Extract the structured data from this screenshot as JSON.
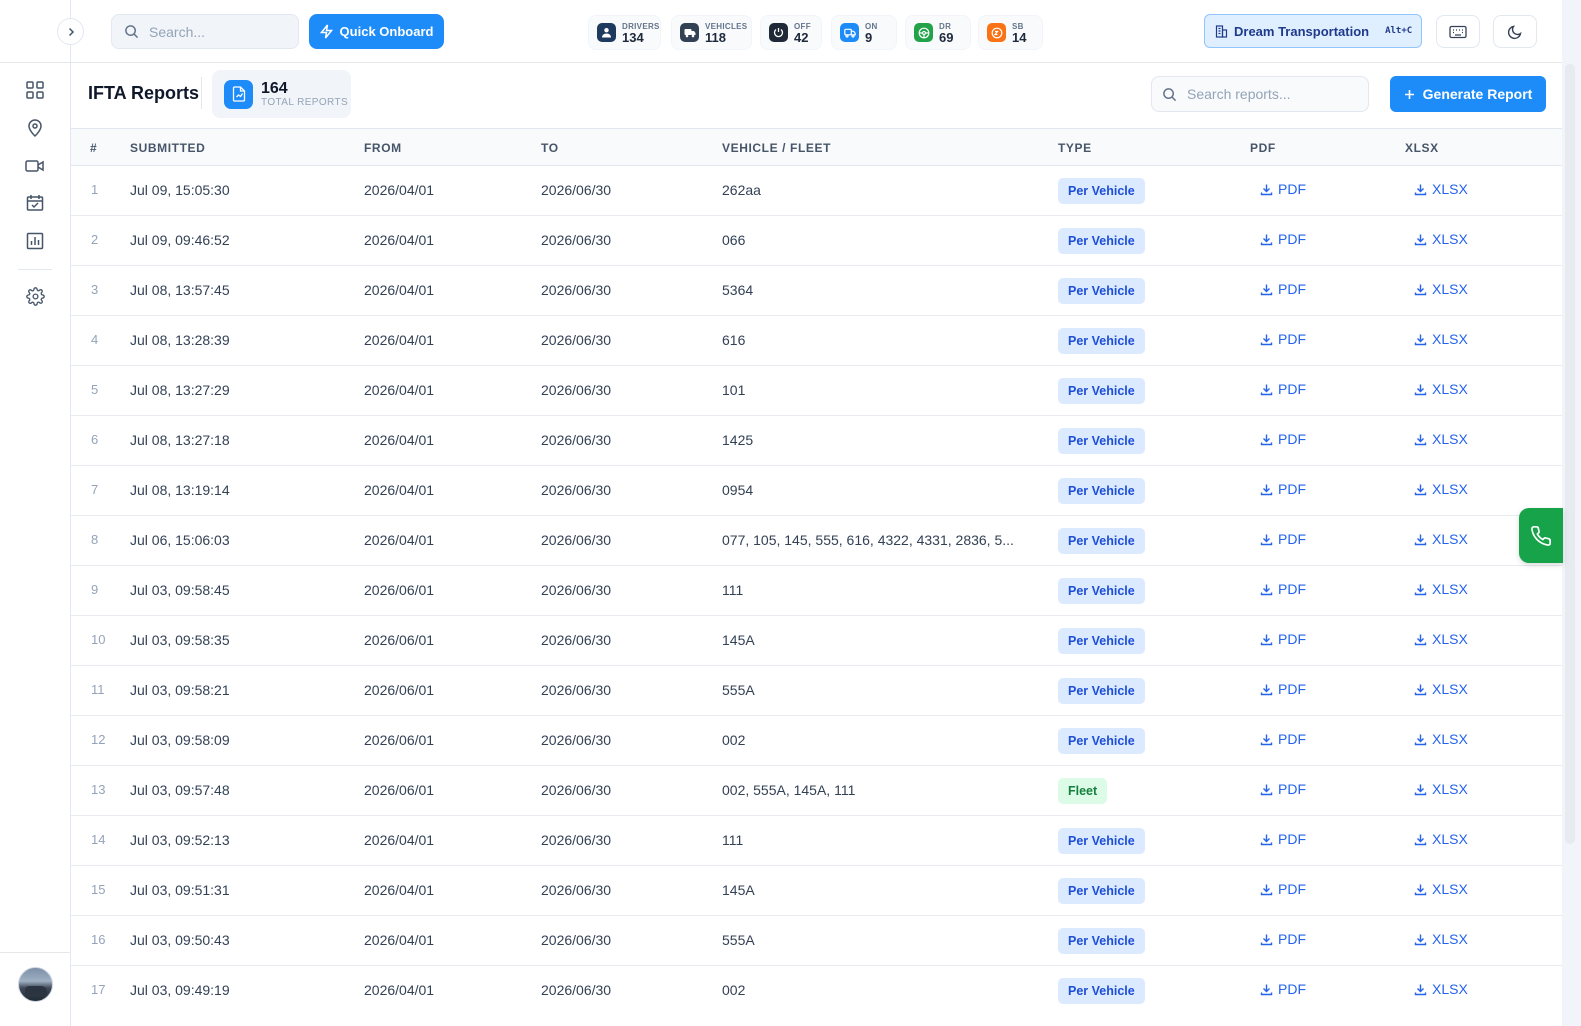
{
  "topbar": {
    "search_placeholder": "Search...",
    "quick_onboard_label": "Quick Onboard",
    "stats": [
      {
        "label": "DRIVERS",
        "value": "134",
        "icon": "driver-icon",
        "color": "#1e3a5f"
      },
      {
        "label": "VEHICLES",
        "value": "118",
        "icon": "truck-icon",
        "color": "#334155"
      },
      {
        "label": "OFF",
        "value": "42",
        "icon": "power-icon",
        "color": "#1f2937"
      },
      {
        "label": "ON",
        "value": "9",
        "icon": "truck-on-icon",
        "color": "#1d8cf8"
      },
      {
        "label": "DR",
        "value": "69",
        "icon": "steering-wheel-icon",
        "color": "#22a34a"
      },
      {
        "label": "SB",
        "value": "14",
        "icon": "sleep-icon",
        "color": "#f97316"
      }
    ],
    "org_name": "Dream Transportation",
    "org_shortcut": "Alt+C"
  },
  "page": {
    "title": "IFTA Reports",
    "total_count": "164",
    "total_label": "TOTAL REPORTS",
    "search_placeholder": "Search reports...",
    "generate_label": "Generate Report"
  },
  "table": {
    "headers": {
      "num": "#",
      "submitted": "SUBMITTED",
      "from": "FROM",
      "to": "TO",
      "vehicle": "VEHICLE / FLEET",
      "type": "TYPE",
      "pdf": "PDF",
      "xlsx": "XLSX"
    },
    "pdf_label": "PDF",
    "xlsx_label": "XLSX",
    "rows": [
      {
        "num": "1",
        "submitted": "Jul 09, 15:05:30",
        "from": "2026/04/01",
        "to": "2026/06/30",
        "vehicle": "262aa",
        "type": "Per Vehicle"
      },
      {
        "num": "2",
        "submitted": "Jul 09, 09:46:52",
        "from": "2026/04/01",
        "to": "2026/06/30",
        "vehicle": "066",
        "type": "Per Vehicle"
      },
      {
        "num": "3",
        "submitted": "Jul 08, 13:57:45",
        "from": "2026/04/01",
        "to": "2026/06/30",
        "vehicle": "5364",
        "type": "Per Vehicle"
      },
      {
        "num": "4",
        "submitted": "Jul 08, 13:28:39",
        "from": "2026/04/01",
        "to": "2026/06/30",
        "vehicle": "616",
        "type": "Per Vehicle"
      },
      {
        "num": "5",
        "submitted": "Jul 08, 13:27:29",
        "from": "2026/04/01",
        "to": "2026/06/30",
        "vehicle": "101",
        "type": "Per Vehicle"
      },
      {
        "num": "6",
        "submitted": "Jul 08, 13:27:18",
        "from": "2026/04/01",
        "to": "2026/06/30",
        "vehicle": "1425",
        "type": "Per Vehicle"
      },
      {
        "num": "7",
        "submitted": "Jul 08, 13:19:14",
        "from": "2026/04/01",
        "to": "2026/06/30",
        "vehicle": "0954",
        "type": "Per Vehicle"
      },
      {
        "num": "8",
        "submitted": "Jul 06, 15:06:03",
        "from": "2026/04/01",
        "to": "2026/06/30",
        "vehicle": "077, 105, 145, 555, 616, 4322, 4331, 2836, 5...",
        "type": "Per Vehicle"
      },
      {
        "num": "9",
        "submitted": "Jul 03, 09:58:45",
        "from": "2026/06/01",
        "to": "2026/06/30",
        "vehicle": "111",
        "type": "Per Vehicle"
      },
      {
        "num": "10",
        "submitted": "Jul 03, 09:58:35",
        "from": "2026/06/01",
        "to": "2026/06/30",
        "vehicle": "145A",
        "type": "Per Vehicle"
      },
      {
        "num": "11",
        "submitted": "Jul 03, 09:58:21",
        "from": "2026/06/01",
        "to": "2026/06/30",
        "vehicle": "555A",
        "type": "Per Vehicle"
      },
      {
        "num": "12",
        "submitted": "Jul 03, 09:58:09",
        "from": "2026/06/01",
        "to": "2026/06/30",
        "vehicle": "002",
        "type": "Per Vehicle"
      },
      {
        "num": "13",
        "submitted": "Jul 03, 09:57:48",
        "from": "2026/06/01",
        "to": "2026/06/30",
        "vehicle": "002, 555A, 145A, 111",
        "type": "Fleet"
      },
      {
        "num": "14",
        "submitted": "Jul 03, 09:52:13",
        "from": "2026/04/01",
        "to": "2026/06/30",
        "vehicle": "111",
        "type": "Per Vehicle"
      },
      {
        "num": "15",
        "submitted": "Jul 03, 09:51:31",
        "from": "2026/04/01",
        "to": "2026/06/30",
        "vehicle": "145A",
        "type": "Per Vehicle"
      },
      {
        "num": "16",
        "submitted": "Jul 03, 09:50:43",
        "from": "2026/04/01",
        "to": "2026/06/30",
        "vehicle": "555A",
        "type": "Per Vehicle"
      },
      {
        "num": "17",
        "submitted": "Jul 03, 09:49:19",
        "from": "2026/04/01",
        "to": "2026/06/30",
        "vehicle": "002",
        "type": "Per Vehicle"
      }
    ]
  },
  "sidebar": {
    "items": [
      {
        "icon": "dashboard-grid-icon"
      },
      {
        "icon": "map-pin-icon"
      },
      {
        "icon": "video-camera-icon"
      },
      {
        "icon": "calendar-check-icon"
      },
      {
        "icon": "bar-chart-icon"
      },
      {
        "icon": "settings-gear-icon"
      }
    ]
  },
  "colors": {
    "accent": "#1d8cf8",
    "per_vehicle_bg": "#dbeafe",
    "fleet_bg": "#dcfce7",
    "call": "#16a34a"
  }
}
